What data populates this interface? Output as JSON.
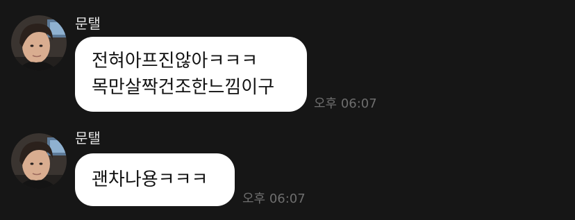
{
  "messages": [
    {
      "sender": "문탤",
      "lines": [
        "전혀아프진않아ㅋㅋㅋ",
        "목만살짝건조한느낌이구"
      ],
      "time": "오후 06:07",
      "avatar": "profile-photo"
    },
    {
      "sender": "문탤",
      "lines": [
        "괜차나용ㅋㅋㅋ"
      ],
      "time": "오후 06:07",
      "avatar": "profile-photo"
    }
  ],
  "colors": {
    "background": "#161616",
    "bubble": "#ffffff",
    "bubble_text": "#111111",
    "sender_text": "#e6e6e6",
    "time_text": "#6e6e6e"
  }
}
